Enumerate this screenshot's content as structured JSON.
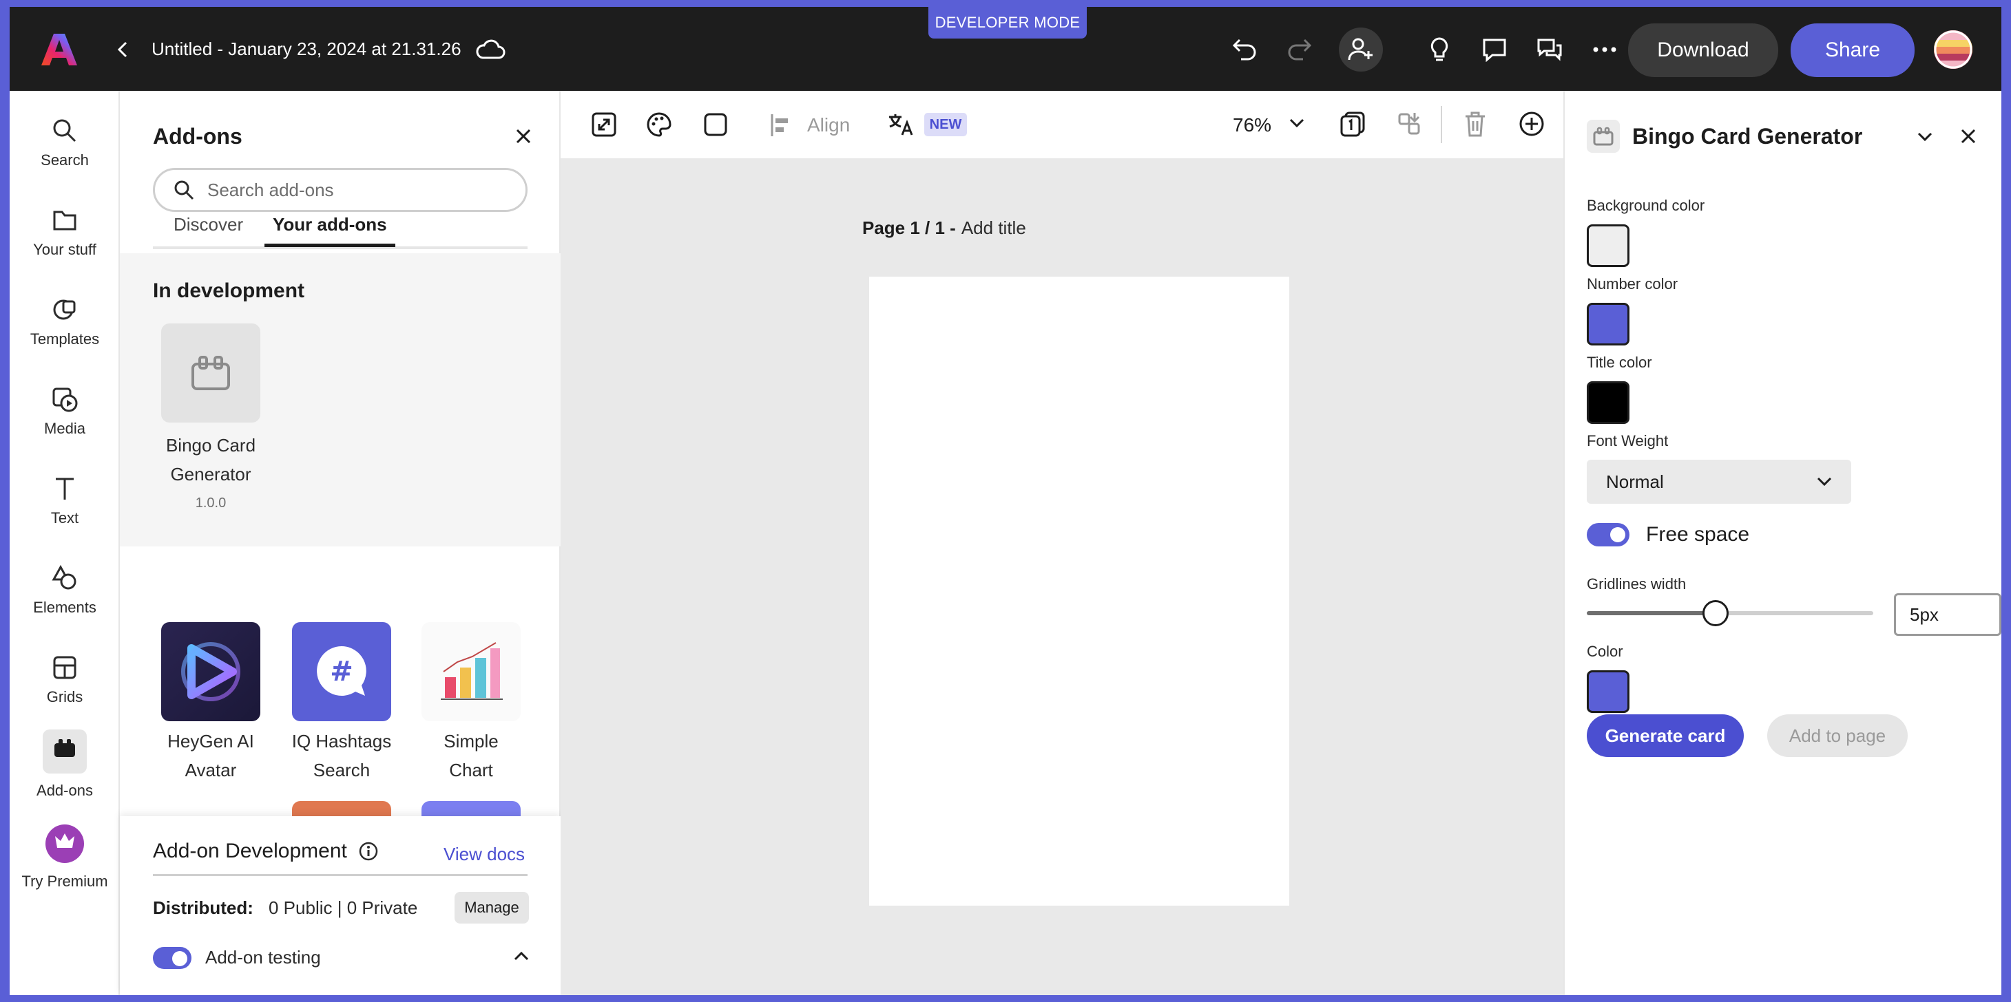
{
  "window": {
    "title": "Untitled - January 23, 2024 at 21.31.26",
    "dev_mode": "DEVELOPER MODE"
  },
  "topbar": {
    "download_label": "Download",
    "share_label": "Share"
  },
  "left_rail": {
    "items": [
      {
        "label": "Search",
        "icon": "search-icon"
      },
      {
        "label": "Your stuff",
        "icon": "folder-icon"
      },
      {
        "label": "Templates",
        "icon": "templates-icon"
      },
      {
        "label": "Media",
        "icon": "media-icon"
      },
      {
        "label": "Text",
        "icon": "text-icon"
      },
      {
        "label": "Elements",
        "icon": "elements-icon"
      },
      {
        "label": "Grids",
        "icon": "grids-icon"
      },
      {
        "label": "Add-ons",
        "icon": "addons-icon"
      },
      {
        "label": "Try Premium",
        "icon": "crown-icon"
      }
    ]
  },
  "addons_panel": {
    "title": "Add-ons",
    "search_placeholder": "Search add-ons",
    "tabs": [
      {
        "label": "Discover"
      },
      {
        "label": "Your add-ons"
      }
    ],
    "in_dev_heading": "In development",
    "dev_addon": {
      "name_line1": "Bingo Card",
      "name_line2": "Generator",
      "version": "1.0.0"
    },
    "addons": [
      {
        "line1": "HeyGen AI",
        "line2": "Avatar"
      },
      {
        "line1": "IQ Hashtags",
        "line2": "Search"
      },
      {
        "line1": "Simple",
        "line2": "Chart"
      }
    ],
    "dev_section": {
      "title": "Add-on Development",
      "view_docs": "View docs",
      "distributed_label": "Distributed:",
      "distributed_value": "0 Public | 0 Private",
      "manage_label": "Manage",
      "testing_label": "Add-on testing"
    }
  },
  "toolbar": {
    "align_label": "Align",
    "new_badge": "NEW",
    "zoom": "76%"
  },
  "canvas": {
    "page_label": "Page 1 / 1 -",
    "page_title_placeholder": "Add title"
  },
  "bingo_panel": {
    "title": "Bingo Card Generator",
    "background_color_label": "Background color",
    "background_color": "#eeeeee",
    "number_color_label": "Number color",
    "number_color": "#5a5fd6",
    "title_color_label": "Title color",
    "title_color": "#000000",
    "font_weight_label": "Font Weight",
    "font_weight_value": "Normal",
    "free_space_label": "Free space",
    "free_space_on": true,
    "gridlines_label": "Gridlines width",
    "gridlines_value": "5px",
    "gridlines_slider_fraction": 0.45,
    "color_label": "Color",
    "color_value": "#5a5fd6",
    "generate_label": "Generate card",
    "add_to_page_label": "Add to page"
  },
  "colors": {
    "accent": "#5a5fd6",
    "topbar": "#1d1d1d",
    "canvas_bg": "#e9e9e9"
  }
}
